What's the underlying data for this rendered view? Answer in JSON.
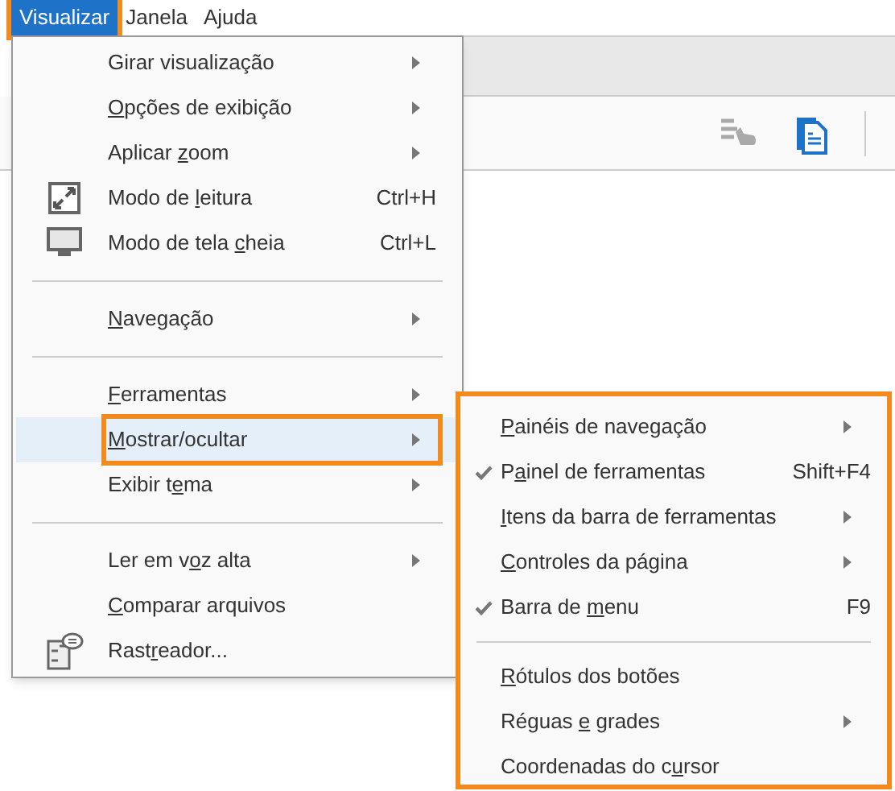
{
  "menubar": [
    {
      "label": "Visualizar",
      "selected": true,
      "callout": true
    },
    {
      "label": "Janela",
      "selected": false,
      "callout": false
    },
    {
      "label": "Ajuda",
      "selected": false,
      "callout": false
    }
  ],
  "menu": [
    {
      "kind": "item",
      "pre": "Girar visualização",
      "submenu": true,
      "selected": false,
      "callout": false
    },
    {
      "kind": "item",
      "key": "O",
      "post": "pções de exibição",
      "submenu": true,
      "selected": false,
      "callout": false
    },
    {
      "kind": "item",
      "pre": "Aplicar ",
      "key": "z",
      "post": "oom",
      "submenu": true,
      "selected": false,
      "callout": false
    },
    {
      "kind": "item",
      "pre": "Modo de ",
      "key": "l",
      "post": "eitura",
      "shortcut": "Ctrl+H",
      "submenu": false,
      "selected": false,
      "callout": false
    },
    {
      "kind": "item",
      "pre": "Modo de tela ",
      "key": "c",
      "post": "heia",
      "shortcut": "Ctrl+L",
      "submenu": false,
      "selected": false,
      "callout": false
    },
    {
      "kind": "separator"
    },
    {
      "kind": "item",
      "key": "N",
      "post": "avegação",
      "submenu": true,
      "selected": false,
      "callout": false
    },
    {
      "kind": "separator"
    },
    {
      "kind": "item",
      "key": "F",
      "post": "erramentas",
      "submenu": true,
      "selected": false,
      "callout": false
    },
    {
      "kind": "item",
      "key": "M",
      "post": "ostrar/ocultar",
      "submenu": true,
      "selected": true,
      "callout": true
    },
    {
      "kind": "item",
      "pre": "Exibir t",
      "key": "e",
      "post": "ma",
      "submenu": true,
      "selected": false,
      "callout": false
    },
    {
      "kind": "separator"
    },
    {
      "kind": "item",
      "pre": "Ler em v",
      "key": "o",
      "post": "z alta",
      "submenu": true,
      "selected": false,
      "callout": false
    },
    {
      "kind": "item",
      "key": "C",
      "post": "omparar arquivos",
      "submenu": false,
      "selected": false,
      "callout": false
    },
    {
      "kind": "item",
      "pre": "Rast",
      "key": "r",
      "post": "eador...",
      "submenu": false,
      "selected": false,
      "callout": false
    }
  ],
  "submenu": {
    "callout": true,
    "items": [
      {
        "kind": "item",
        "key": "P",
        "post": "ainéis de navegação",
        "submenu": true,
        "checked": false
      },
      {
        "kind": "item",
        "pre": "P",
        "key": "a",
        "post": "inel de ferramentas",
        "shortcut": "Shift+F4",
        "submenu": false,
        "checked": true
      },
      {
        "kind": "item",
        "key": "I",
        "post": "tens da barra de ferramentas",
        "submenu": true,
        "checked": false
      },
      {
        "kind": "item",
        "key": "C",
        "post": "ontroles da página",
        "submenu": true,
        "checked": false
      },
      {
        "kind": "item",
        "pre": "Barra de ",
        "key": "m",
        "post": "enu",
        "shortcut": "F9",
        "submenu": false,
        "checked": true
      },
      {
        "kind": "separator"
      },
      {
        "kind": "item",
        "key": "R",
        "post": "ótulos dos botões",
        "submenu": false,
        "checked": false
      },
      {
        "kind": "item",
        "pre": "Réguas ",
        "key": "e",
        "post": " grades",
        "submenu": true,
        "checked": false
      },
      {
        "kind": "item",
        "pre": "Coordenadas do c",
        "key": "u",
        "post": "rsor",
        "submenu": false,
        "checked": false
      }
    ]
  }
}
